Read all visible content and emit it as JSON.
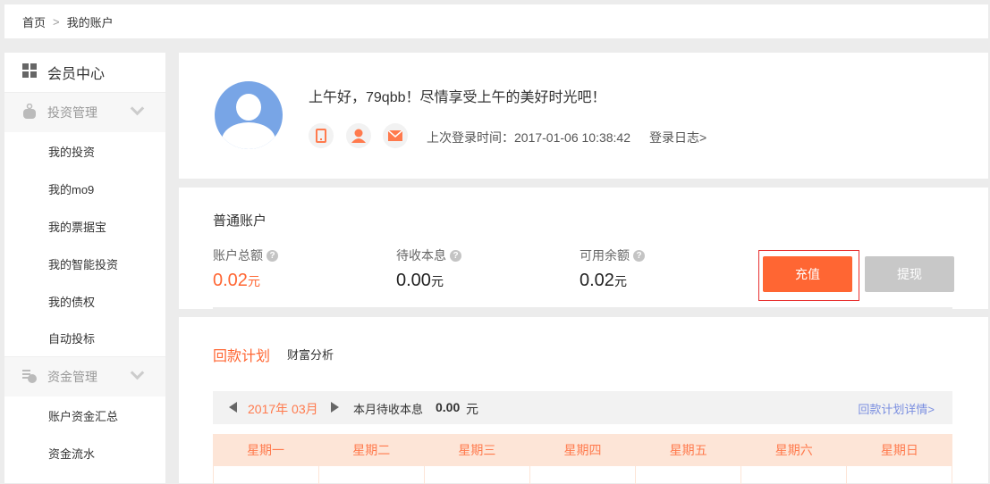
{
  "breadcrumb": {
    "home": "首页",
    "separator": ">",
    "current": "我的账户"
  },
  "sidebar": {
    "top": "会员中心",
    "groups": [
      {
        "label": "投资管理",
        "items": [
          "我的投资",
          "我的mo9",
          "我的票据宝",
          "我的智能投资",
          "我的债权",
          "自动投标"
        ]
      },
      {
        "label": "资金管理",
        "items": [
          "账户资金汇总",
          "资金流水"
        ]
      }
    ]
  },
  "profile": {
    "greeting": "上午好，79qbb！尽情享受上午的美好时光吧！",
    "last_login": "上次登录时间：2017-01-06 10:38:42",
    "login_log": "登录日志>"
  },
  "account": {
    "title": "普通账户",
    "stats": [
      {
        "label": "账户总额",
        "value": "0.02",
        "unit": "元"
      },
      {
        "label": "待收本息",
        "value": "0.00",
        "unit": "元"
      },
      {
        "label": "可用余额",
        "value": "0.02",
        "unit": "元"
      }
    ],
    "recharge": "充值",
    "withdraw": "提现",
    "help": "?"
  },
  "plan": {
    "tabs": [
      "回款计划",
      "财富分析"
    ],
    "month": "2017年 03月",
    "pending_label": "本月待收本息",
    "pending_value": "0.00",
    "pending_unit": "元",
    "detail_link": "回款计划详情>",
    "weekdays": [
      "星期一",
      "星期二",
      "星期三",
      "星期四",
      "星期五",
      "星期六",
      "星期日"
    ]
  },
  "colors": {
    "accent": "#ff6633",
    "link": "#7b8fe0",
    "header_bg": "#fde5d7"
  }
}
